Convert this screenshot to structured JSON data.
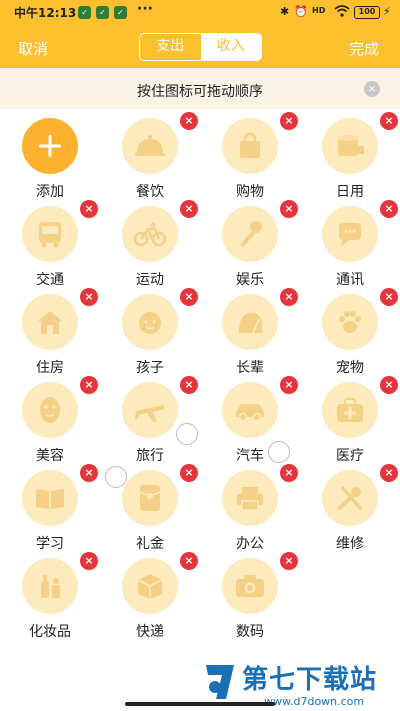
{
  "status": {
    "time": "中午12:13",
    "dots": "···",
    "network": "HD",
    "battery": "100"
  },
  "header": {
    "cancel": "取消",
    "done": "完成",
    "tabs": [
      "支出",
      "收入"
    ],
    "active_tab": "支出"
  },
  "hint": {
    "text": "按住图标可拖动顺序",
    "close": "×"
  },
  "colors": {
    "brand": "#fcc02e",
    "icon_bg": "#fdeabd",
    "icon_fg": "#f4d187",
    "delete": "#e4363b"
  },
  "categories": [
    {
      "label": "添加",
      "icon": "plus-icon"
    },
    {
      "label": "餐饮",
      "icon": "dish-icon"
    },
    {
      "label": "购物",
      "icon": "shopping-bag-icon"
    },
    {
      "label": "日用",
      "icon": "tissue-roll-icon"
    },
    {
      "label": "交通",
      "icon": "bus-icon"
    },
    {
      "label": "运动",
      "icon": "bicycle-icon"
    },
    {
      "label": "娱乐",
      "icon": "microphone-icon"
    },
    {
      "label": "通讯",
      "icon": "chat-phone-icon"
    },
    {
      "label": "住房",
      "icon": "house-icon"
    },
    {
      "label": "孩子",
      "icon": "baby-face-icon"
    },
    {
      "label": "长辈",
      "icon": "elder-icon"
    },
    {
      "label": "宠物",
      "icon": "paw-icon"
    },
    {
      "label": "美容",
      "icon": "face-mask-icon"
    },
    {
      "label": "旅行",
      "icon": "airplane-icon"
    },
    {
      "label": "汽车",
      "icon": "car-icon"
    },
    {
      "label": "医疗",
      "icon": "medical-kit-icon"
    },
    {
      "label": "学习",
      "icon": "book-icon"
    },
    {
      "label": "礼金",
      "icon": "red-envelope-icon"
    },
    {
      "label": "办公",
      "icon": "printer-icon"
    },
    {
      "label": "维修",
      "icon": "tools-icon"
    },
    {
      "label": "化妆品",
      "icon": "cosmetics-icon"
    },
    {
      "label": "快递",
      "icon": "package-icon"
    },
    {
      "label": "数码",
      "icon": "camera-icon"
    }
  ],
  "delete_symbol": "×",
  "watermark": {
    "name": "第七下载站",
    "url": "www.d7down.com"
  }
}
